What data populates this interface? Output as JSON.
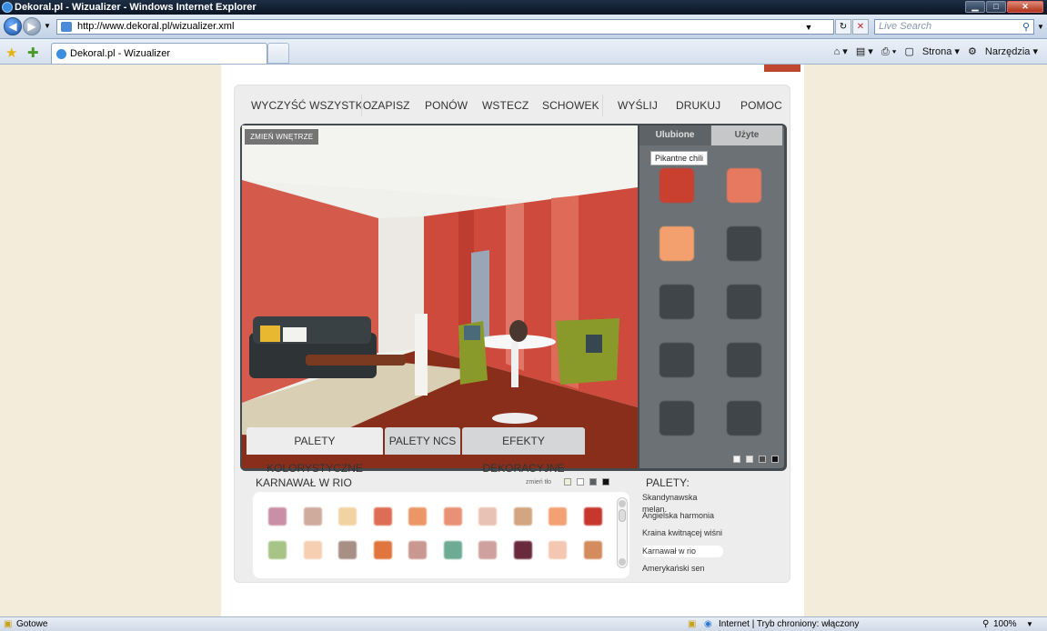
{
  "window": {
    "title": "Dekoral.pl - Wizualizer - Windows Internet Explorer"
  },
  "browser": {
    "url": "http://www.dekoral.pl/wizualizer.xml",
    "search_placeholder": "Live Search",
    "tab_title": "Dekoral.pl - Wizualizer",
    "cmd": {
      "page": "Strona",
      "tools": "Narzędzia"
    }
  },
  "toolbar": {
    "clear_all": "WYCZYŚĆ WSZYSTKO",
    "save": "ZAPISZ",
    "redo": "PONÓW",
    "undo": "WSTECZ",
    "clipboard": "SCHOWEK",
    "send": "WYŚLIJ",
    "print": "DRUKUJ",
    "help": "POMOC"
  },
  "visual": {
    "change_interior": "ZMIEŃ WNĘTRZE"
  },
  "side_panel": {
    "tab_favorites": "Ulubione",
    "tab_used": "Użyte",
    "tooltip": "Pikantne chili",
    "swatches": [
      "#c9402e",
      "#e6795f",
      "#f3a06e",
      "#3f4548",
      "#3f4548",
      "#3f4548",
      "#3f4548",
      "#3f4548",
      "#3f4548",
      "#3f4548"
    ],
    "bg_colors": [
      "#f5f5f5",
      "#e8e8e8",
      "#4a4a4a",
      "#111111"
    ]
  },
  "bottom_tabs": {
    "color_palettes": "PALETY KOLORYSTYCZNE",
    "ncs_palettes": "PALETY NCS",
    "decorative_effects": "EFEKTY DEKORACYJNE"
  },
  "palette": {
    "name": "KARNAWAŁ W RIO",
    "change_bg": "zmień tło",
    "bg_colors": [
      "#eef0d6",
      "#ffffff",
      "#5a5f62",
      "#111111"
    ],
    "row1": [
      "#c98fa5",
      "#cfab9e",
      "#f1d3a3",
      "#dd6e55",
      "#ec9668",
      "#e99176",
      "#e8c2b4",
      "#d3a682",
      "#f3a173",
      "#c8372e"
    ],
    "row2": [
      "#a7c486",
      "#f6cfb2",
      "#a78f86",
      "#e0753e",
      "#c99890",
      "#6dab94",
      "#cfa19e",
      "#6a2a3d",
      "#f4c7b3",
      "#d48b5e"
    ]
  },
  "palettes": {
    "heading": "PALETY:",
    "items": [
      "Skandynawska melan.",
      "Angielska harmonia",
      "Kraina kwitnącej wiśni",
      "Karnawał w rio",
      "Amerykański sen"
    ],
    "selected_index": 3
  },
  "status": {
    "ready": "Gotowe",
    "zone": "Internet | Tryb chroniony: włączony",
    "zoom": "100%"
  }
}
